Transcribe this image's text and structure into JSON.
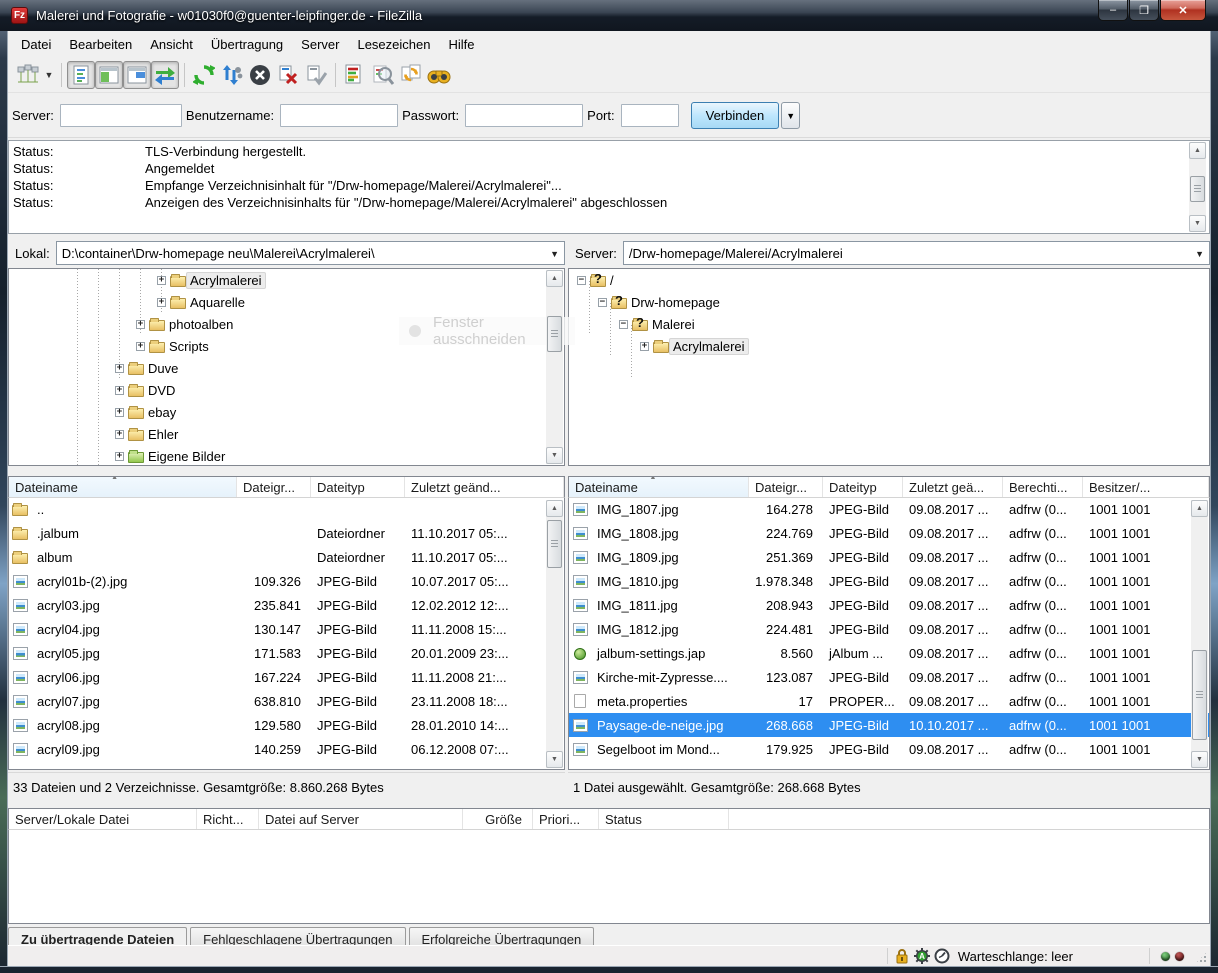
{
  "window": {
    "title": "Malerei und Fotografie - w01030f0@guenter-leipfinger.de - FileZilla"
  },
  "window_controls": {
    "minimize": "–",
    "maximize": "❐",
    "close": "✕"
  },
  "menu": {
    "items": [
      "Datei",
      "Bearbeiten",
      "Ansicht",
      "Übertragung",
      "Server",
      "Lesezeichen",
      "Hilfe"
    ]
  },
  "toolbar": {
    "icon_names": [
      "site-manager-icon",
      "toggle-message-log-icon",
      "toggle-local-tree-icon",
      "toggle-remote-tree-icon",
      "toggle-transfer-queue-icon",
      "refresh-icon",
      "process-queue-icon",
      "cancel-icon",
      "disconnect-icon",
      "reconnect-icon",
      "directory-comparison-icon",
      "filter-icon",
      "synchronized-browsing-icon",
      "find-files-icon"
    ]
  },
  "quickconnect": {
    "server_label": "Server:",
    "user_label": "Benutzername:",
    "password_label": "Passwort:",
    "port_label": "Port:",
    "connect_button": "Verbinden",
    "dropdown_glyph": "▼"
  },
  "log": {
    "rows": [
      {
        "label": "Status:",
        "text": "TLS-Verbindung hergestellt."
      },
      {
        "label": "Status:",
        "text": "Angemeldet"
      },
      {
        "label": "Status:",
        "text": "Empfange Verzeichnisinhalt für \"/Drw-homepage/Malerei/Acrylmalerei\"..."
      },
      {
        "label": "Status:",
        "text": "Anzeigen des Verzeichnisinhalts für \"/Drw-homepage/Malerei/Acrylmalerei\" abgeschlossen"
      }
    ]
  },
  "local": {
    "path_label": "Lokal:",
    "path_value": "D:\\container\\Drw-homepage neu\\Malerei\\Acrylmalerei\\",
    "tree": [
      {
        "label": "Acrylmalerei",
        "indent": 148,
        "icon": "folder",
        "expander": "plus",
        "selected": true
      },
      {
        "label": "Aquarelle",
        "indent": 148,
        "icon": "folder",
        "expander": "plus"
      },
      {
        "label": "photoalben",
        "indent": 127,
        "icon": "folder",
        "expander": "plus"
      },
      {
        "label": "Scripts",
        "indent": 127,
        "icon": "folder",
        "expander": "plus"
      },
      {
        "label": "Duve",
        "indent": 106,
        "icon": "folder",
        "expander": "plus"
      },
      {
        "label": "DVD",
        "indent": 106,
        "icon": "folder",
        "expander": "plus"
      },
      {
        "label": "ebay",
        "indent": 106,
        "icon": "folder",
        "expander": "plus"
      },
      {
        "label": "Ehler",
        "indent": 106,
        "icon": "folder",
        "expander": "plus"
      },
      {
        "label": "Eigene Bilder",
        "indent": 106,
        "icon": "folder-green",
        "expander": "plus"
      }
    ],
    "columns": [
      {
        "label": "Dateiname",
        "sorted": true
      },
      {
        "label": "Dateigr..."
      },
      {
        "label": "Dateityp"
      },
      {
        "label": "Zuletzt geänd..."
      }
    ],
    "rows": [
      {
        "icon": "folder",
        "name": "..",
        "size": "",
        "type": "",
        "date": ""
      },
      {
        "icon": "folder",
        "name": ".jalbum",
        "size": "",
        "type": "Dateiordner",
        "date": "11.10.2017 05:..."
      },
      {
        "icon": "folder",
        "name": "album",
        "size": "",
        "type": "Dateiordner",
        "date": "11.10.2017 05:..."
      },
      {
        "icon": "image",
        "name": "acryl01b-(2).jpg",
        "size": "109.326",
        "type": "JPEG-Bild",
        "date": "10.07.2017 05:..."
      },
      {
        "icon": "image",
        "name": "acryl03.jpg",
        "size": "235.841",
        "type": "JPEG-Bild",
        "date": "12.02.2012 12:..."
      },
      {
        "icon": "image",
        "name": "acryl04.jpg",
        "size": "130.147",
        "type": "JPEG-Bild",
        "date": "11.11.2008 15:..."
      },
      {
        "icon": "image",
        "name": "acryl05.jpg",
        "size": "171.583",
        "type": "JPEG-Bild",
        "date": "20.01.2009 23:..."
      },
      {
        "icon": "image",
        "name": "acryl06.jpg",
        "size": "167.224",
        "type": "JPEG-Bild",
        "date": "11.11.2008 21:..."
      },
      {
        "icon": "image",
        "name": "acryl07.jpg",
        "size": "638.810",
        "type": "JPEG-Bild",
        "date": "23.11.2008 18:..."
      },
      {
        "icon": "image",
        "name": "acryl08.jpg",
        "size": "129.580",
        "type": "JPEG-Bild",
        "date": "28.01.2010 14:..."
      },
      {
        "icon": "image",
        "name": "acryl09.jpg",
        "size": "140.259",
        "type": "JPEG-Bild",
        "date": "06.12.2008 07:..."
      }
    ],
    "status": "33 Dateien und 2 Verzeichnisse. Gesamtgröße: 8.860.268 Bytes"
  },
  "remote": {
    "path_label": "Server:",
    "path_value": "/Drw-homepage/Malerei/Acrylmalerei",
    "tree": [
      {
        "label": "/",
        "indent": 8,
        "icon": "folder-q",
        "expander": "minus"
      },
      {
        "label": "Drw-homepage",
        "indent": 29,
        "icon": "folder-q",
        "expander": "minus"
      },
      {
        "label": "Malerei",
        "indent": 50,
        "icon": "folder-q",
        "expander": "minus"
      },
      {
        "label": "Acrylmalerei",
        "indent": 71,
        "icon": "folder",
        "expander": "plus",
        "selected": true
      }
    ],
    "columns": [
      {
        "label": "Dateiname",
        "sorted": true
      },
      {
        "label": "Dateigr..."
      },
      {
        "label": "Dateityp"
      },
      {
        "label": "Zuletzt geä..."
      },
      {
        "label": "Berechti..."
      },
      {
        "label": "Besitzer/..."
      }
    ],
    "rows": [
      {
        "icon": "image",
        "name": "IMG_1807.jpg",
        "size": "164.278",
        "type": "JPEG-Bild",
        "date": "09.08.2017 ...",
        "perm": "adfrw (0...",
        "owner": "1001 1001"
      },
      {
        "icon": "image",
        "name": "IMG_1808.jpg",
        "size": "224.769",
        "type": "JPEG-Bild",
        "date": "09.08.2017 ...",
        "perm": "adfrw (0...",
        "owner": "1001 1001"
      },
      {
        "icon": "image",
        "name": "IMG_1809.jpg",
        "size": "251.369",
        "type": "JPEG-Bild",
        "date": "09.08.2017 ...",
        "perm": "adfrw (0...",
        "owner": "1001 1001"
      },
      {
        "icon": "image",
        "name": "IMG_1810.jpg",
        "size": "1.978.348",
        "type": "JPEG-Bild",
        "date": "09.08.2017 ...",
        "perm": "adfrw (0...",
        "owner": "1001 1001"
      },
      {
        "icon": "image",
        "name": "IMG_1811.jpg",
        "size": "208.943",
        "type": "JPEG-Bild",
        "date": "09.08.2017 ...",
        "perm": "adfrw (0...",
        "owner": "1001 1001"
      },
      {
        "icon": "image",
        "name": "IMG_1812.jpg",
        "size": "224.481",
        "type": "JPEG-Bild",
        "date": "09.08.2017 ...",
        "perm": "adfrw (0...",
        "owner": "1001 1001"
      },
      {
        "icon": "jalbum",
        "name": "jalbum-settings.jap",
        "size": "8.560",
        "type": "jAlbum ...",
        "date": "09.08.2017 ...",
        "perm": "adfrw (0...",
        "owner": "1001 1001"
      },
      {
        "icon": "image",
        "name": "Kirche-mit-Zypresse....",
        "size": "123.087",
        "type": "JPEG-Bild",
        "date": "09.08.2017 ...",
        "perm": "adfrw (0...",
        "owner": "1001 1001"
      },
      {
        "icon": "file",
        "name": "meta.properties",
        "size": "17",
        "type": "PROPER...",
        "date": "09.08.2017 ...",
        "perm": "adfrw (0...",
        "owner": "1001 1001"
      },
      {
        "icon": "image",
        "name": "Paysage-de-neige.jpg",
        "size": "268.668",
        "type": "JPEG-Bild",
        "date": "10.10.2017 ...",
        "perm": "adfrw (0...",
        "owner": "1001 1001",
        "selected": true
      },
      {
        "icon": "image",
        "name": "Segelboot im Mond...",
        "size": "179.925",
        "type": "JPEG-Bild",
        "date": "09.08.2017 ...",
        "perm": "adfrw (0...",
        "owner": "1001 1001"
      }
    ],
    "status": "1 Datei ausgewählt. Gesamtgröße: 268.668 Bytes"
  },
  "queue": {
    "columns": [
      {
        "label": "Server/Lokale Datei"
      },
      {
        "label": "Richt..."
      },
      {
        "label": "Datei auf Server"
      },
      {
        "label": "Größe"
      },
      {
        "label": "Priori..."
      },
      {
        "label": "Status"
      }
    ]
  },
  "tabs": [
    {
      "label": "Zu übertragende Dateien",
      "active": true
    },
    {
      "label": "Fehlgeschlagene Übertragungen"
    },
    {
      "label": "Erfolgreiche Übertragungen"
    }
  ],
  "statusbar": {
    "queue_text": "Warteschlange: leer",
    "icon_names": [
      "lock-icon",
      "gear-icon",
      "gauge-icon"
    ]
  },
  "overlay": {
    "text": "Fenster ausschneiden"
  },
  "colors": {
    "selection": "#2e8ef1",
    "titlebar_dark": "#10161f",
    "connect_button": "#bee6fd",
    "folder": "#e8c064",
    "close_button": "#b03121"
  }
}
